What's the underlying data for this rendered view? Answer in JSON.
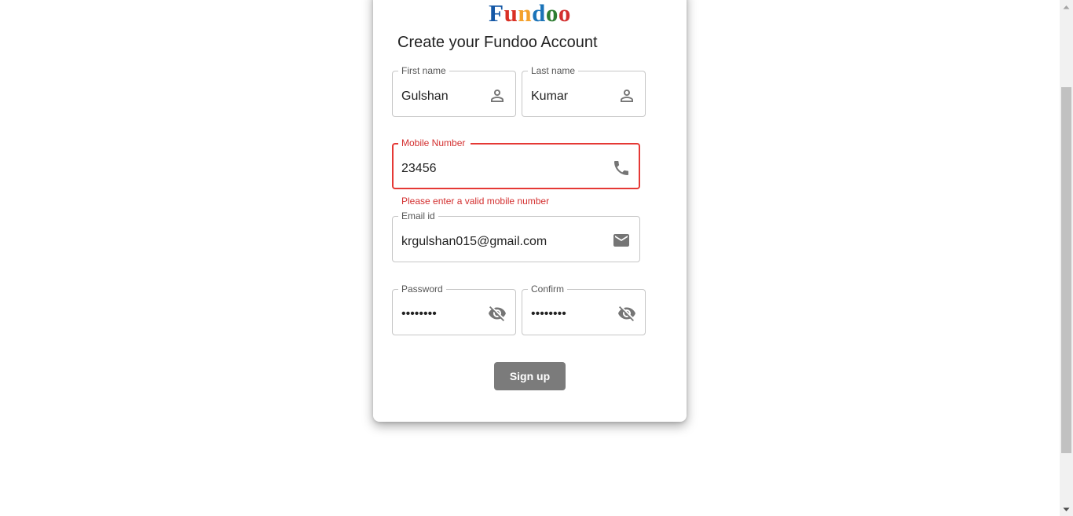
{
  "logo": {
    "letters": [
      {
        "char": "F",
        "color": "#1558a6"
      },
      {
        "char": "u",
        "color": "#d93025"
      },
      {
        "char": "n",
        "color": "#f4a12b"
      },
      {
        "char": "d",
        "color": "#1a73b8"
      },
      {
        "char": "o",
        "color": "#2e7d32"
      },
      {
        "char": "o",
        "color": "#d32f2f"
      }
    ]
  },
  "heading": "Create your Fundoo Account",
  "form": {
    "first_name": {
      "label": "First name",
      "value": "Gulshan",
      "icon": "person-icon"
    },
    "last_name": {
      "label": "Last name",
      "value": "Kumar",
      "icon": "person-icon"
    },
    "mobile": {
      "label": "Mobile Number",
      "value": "23456",
      "icon": "phone-icon",
      "error": "Please enter a valid mobile number"
    },
    "email": {
      "label": "Email id",
      "value": "krgulshan015@gmail.com",
      "icon": "mail-icon"
    },
    "password": {
      "label": "Password",
      "value": "••••••••",
      "icon": "visibility-off-icon"
    },
    "confirm": {
      "label": "Confirm",
      "value": "••••••••",
      "icon": "visibility-off-icon"
    }
  },
  "signup_label": "Sign up",
  "colors": {
    "error": "#e53935",
    "button": "#7b7b7b",
    "icon": "#757575"
  }
}
